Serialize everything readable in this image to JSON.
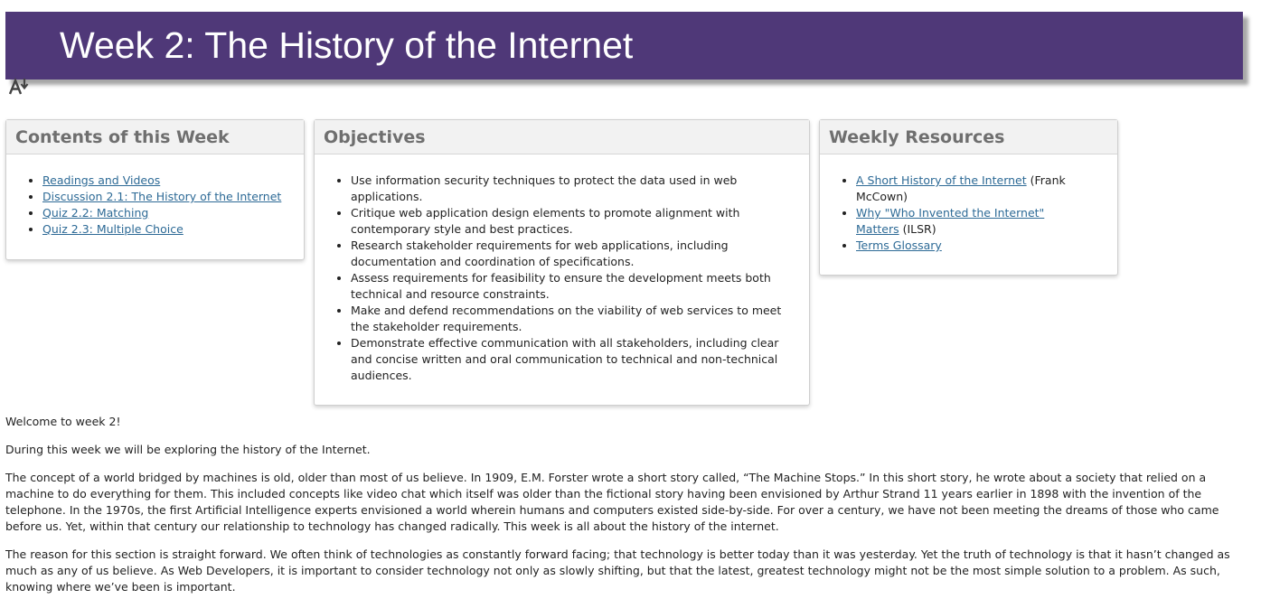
{
  "banner": {
    "title": "Week 2: The History of the Internet"
  },
  "contents_card": {
    "title": "Contents of this Week",
    "items": [
      "Readings and Videos",
      "Discussion 2.1: The History of the Internet",
      "Quiz 2.2: Matching",
      "Quiz 2.3: Multiple Choice"
    ]
  },
  "objectives_card": {
    "title": "Objectives",
    "items": [
      "Use information security techniques to protect the data used in web applications.",
      "Critique web application design elements to promote alignment with contemporary style and best practices.",
      "Research stakeholder requirements for web applications, including documentation and coordination of specifications.",
      "Assess requirements for feasibility to ensure the development meets both technical and resource constraints.",
      "Make and defend recommendations on the viability of web services to meet the stakeholder requirements.",
      "Demonstrate effective communication with all stakeholders, including clear and concise written and oral communication to technical and non-technical audiences."
    ]
  },
  "resources_card": {
    "title": "Weekly Resources",
    "items": [
      {
        "link": "A Short History of the Internet",
        "suffix": " (Frank McCown)"
      },
      {
        "link": "Why \"Who Invented the Internet\" Matters",
        "suffix": " (ILSR)"
      },
      {
        "link": "Terms Glossary",
        "suffix": ""
      }
    ]
  },
  "body": {
    "p1": "Welcome to week 2!",
    "p2": "During this week we will be exploring the history of the Internet.",
    "p3": "The concept of a world bridged by machines is old, older than most of us believe. In 1909, E.M. Forster wrote a short story called, “The Machine Stops.” In this short story, he wrote about a society that relied on a machine to do everything for them. This included concepts like video chat which itself was older than the fictional story having been envisioned by Arthur Strand 11 years earlier in 1898 with the invention of the telephone. In the 1970s, the first Artificial Intelligence experts envisioned a world wherein humans and computers existed side-by-side. For over a century, we have not been meeting the dreams of those who came before us. Yet, within that century our relationship to technology has changed radically. This week is all about the history of the internet.",
    "p4": "The reason for this section is straight forward. We often think of technologies as constantly forward facing; that technology is better today than it was yesterday. Yet the truth of technology is that it hasn’t changed as much as any of us believe. As Web Developers, it is important to consider technology not only as slowly shifting, but that the latest, greatest technology might not be the most simple solution to a problem. As such, knowing where we’ve been is important."
  },
  "colors": {
    "banner_bg": "#4f3878",
    "link": "#2d6a96",
    "card_header_text": "#6f6f6f"
  },
  "icons": {
    "a11y": "text-to-speech-icon"
  }
}
